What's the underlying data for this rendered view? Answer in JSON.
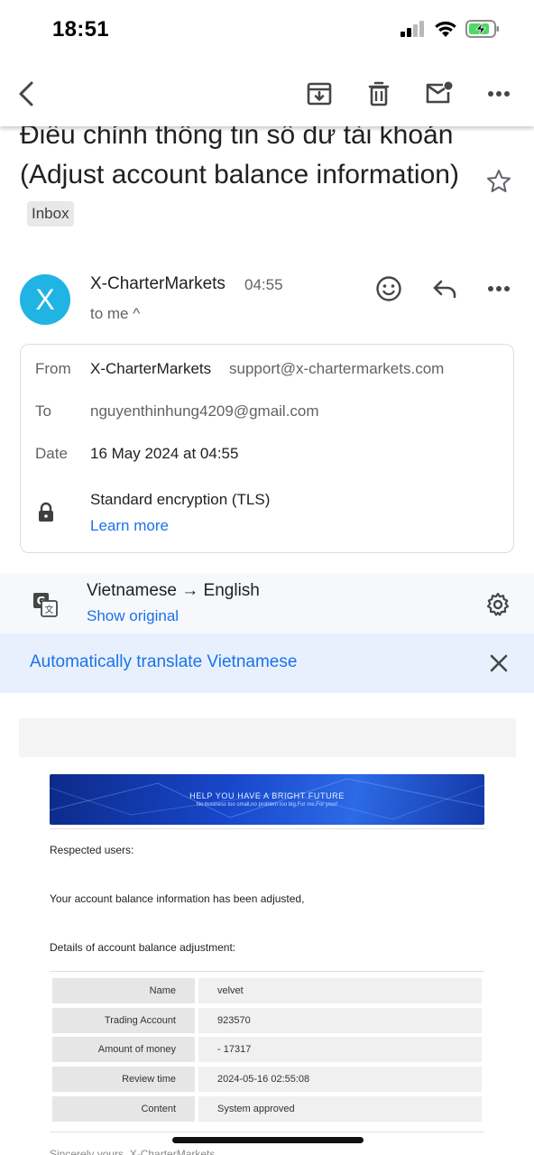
{
  "status_bar": {
    "time": "18:51"
  },
  "email": {
    "subject": "Điều chỉnh thông tin số dư tài khoản (Adjust account balance information)",
    "label": "Inbox",
    "sender_initial": "X",
    "sender_name": "X-CharterMarkets",
    "time": "04:55",
    "to_line": "to me ^",
    "details": {
      "from_label": "From",
      "from_name": "X-CharterMarkets",
      "from_email": "support@x-chartermarkets.com",
      "to_label": "To",
      "to_value": "nguyenthinhung4209@gmail.com",
      "date_label": "Date",
      "date_value": "16 May 2024 at 04:55",
      "encryption": "Standard encryption (TLS)",
      "learn_more": "Learn more"
    }
  },
  "translation": {
    "languages": "Vietnamese → English",
    "show_original": "Show original",
    "auto_translate": "Automatically translate Vietnamese"
  },
  "content": {
    "banner_title": "HELP YOU HAVE A BRIGHT FUTURE",
    "banner_sub": "No business too small,no problem too big,For me,For your!",
    "greeting": "Respected users:",
    "line1": "Your account balance information has been adjusted,",
    "line2": "Details of account balance adjustment:",
    "table": [
      {
        "label": "Name",
        "value": "velvet"
      },
      {
        "label": "Trading Account",
        "value": "923570"
      },
      {
        "label": "Amount of money",
        "value": "- 17317"
      },
      {
        "label": "Review time",
        "value": "2024-05-16 02:55:08"
      },
      {
        "label": "Content",
        "value": "System approved"
      }
    ],
    "footer": "Sincerely yours, X-CharterMarkets"
  },
  "colors": {
    "accent": "#1a73e8",
    "avatar": "#1fb4e4"
  }
}
